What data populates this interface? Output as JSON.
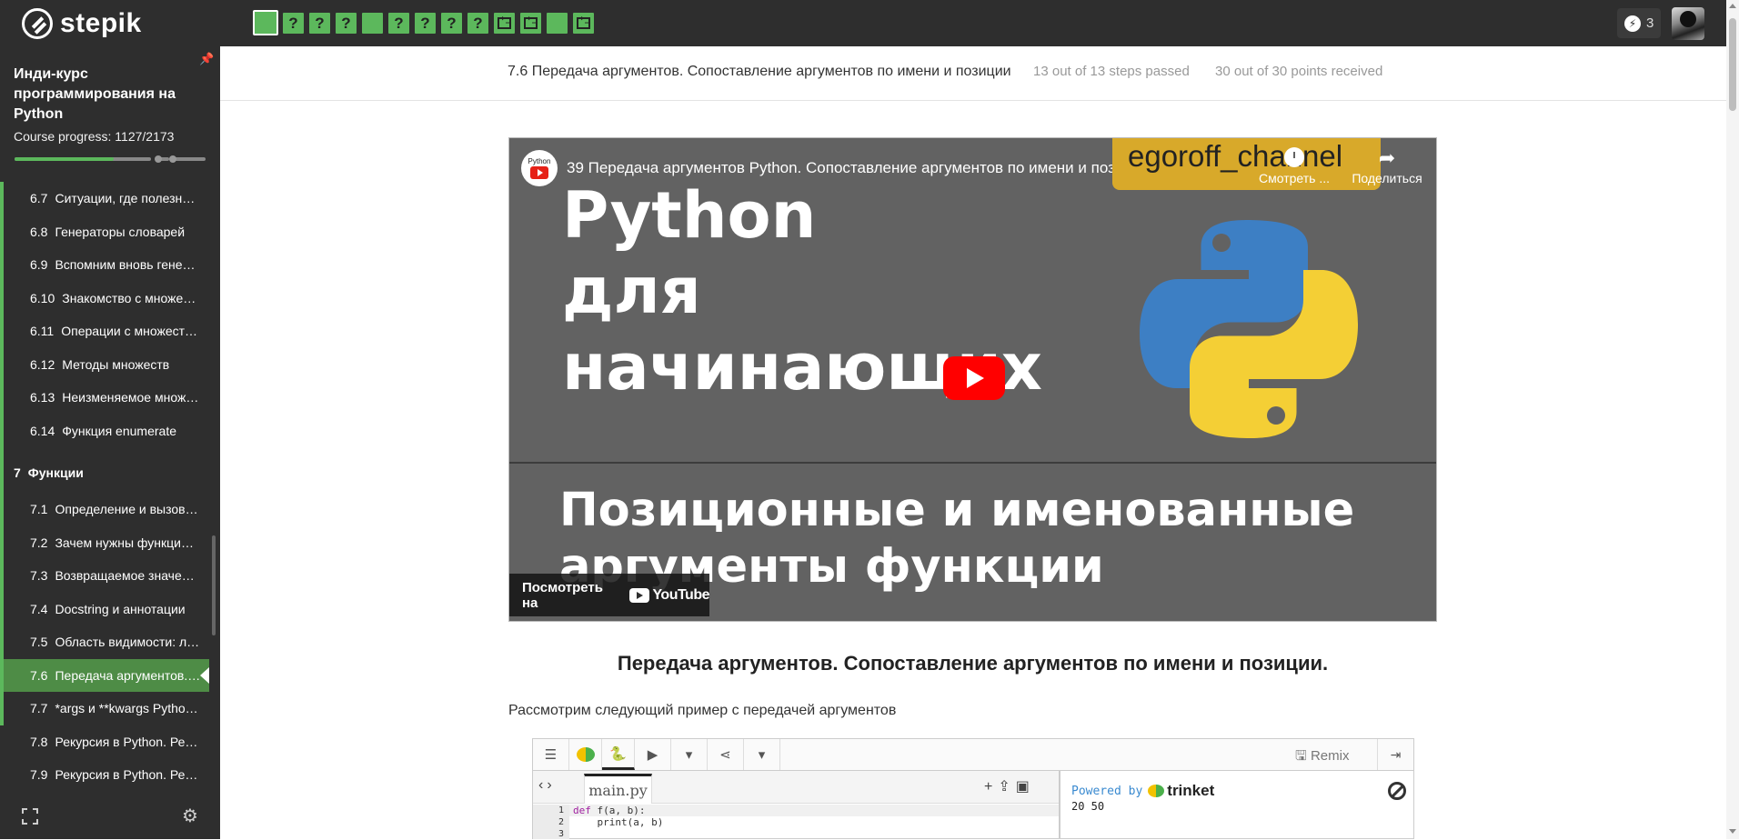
{
  "topbar": {
    "logo_text": "stepik",
    "steps": [
      {
        "kind": "check",
        "label": "",
        "active": true
      },
      {
        "kind": "question",
        "label": "?"
      },
      {
        "kind": "question",
        "label": "?"
      },
      {
        "kind": "question",
        "label": "?"
      },
      {
        "kind": "check",
        "label": ""
      },
      {
        "kind": "question",
        "label": "?"
      },
      {
        "kind": "question",
        "label": "?"
      },
      {
        "kind": "question",
        "label": "?"
      },
      {
        "kind": "question",
        "label": "?"
      },
      {
        "kind": "code",
        "label": ""
      },
      {
        "kind": "code",
        "label": ""
      },
      {
        "kind": "check",
        "label": ""
      },
      {
        "kind": "code",
        "label": ""
      }
    ],
    "energy_count": "3"
  },
  "sidebar": {
    "course_title": "Инди-курс программирования на Python",
    "progress_label": "Course progress:",
    "progress_value": "1127/2173",
    "progress_fraction": 0.52,
    "lessons": [
      {
        "num": "6.7",
        "title": "Ситуации, где полезно…",
        "type": "lesson"
      },
      {
        "num": "6.8",
        "title": "Генераторы словарей",
        "type": "lesson"
      },
      {
        "num": "6.9",
        "title": "Вспомним вновь гене…",
        "type": "lesson"
      },
      {
        "num": "6.10",
        "title": "Знакомство с множе…",
        "type": "lesson"
      },
      {
        "num": "6.11",
        "title": "Операции с множест…",
        "type": "lesson"
      },
      {
        "num": "6.12",
        "title": "Методы множеств",
        "type": "lesson"
      },
      {
        "num": "6.13",
        "title": "Неизменяемое множ…",
        "type": "lesson"
      },
      {
        "num": "6.14",
        "title": "Функция enumerate",
        "type": "lesson"
      },
      {
        "num": "7",
        "title": "Функции",
        "type": "module"
      },
      {
        "num": "7.1",
        "title": "Определение и вызов …",
        "type": "lesson"
      },
      {
        "num": "7.2",
        "title": "Зачем нужны функции…",
        "type": "lesson"
      },
      {
        "num": "7.3",
        "title": "Возвращаемое значен…",
        "type": "lesson"
      },
      {
        "num": "7.4",
        "title": "Docstring и аннотации",
        "type": "lesson"
      },
      {
        "num": "7.5",
        "title": "Область видимости: л…",
        "type": "lesson"
      },
      {
        "num": "7.6",
        "title": "Передача аргументов.…",
        "type": "current"
      },
      {
        "num": "7.7",
        "title": "*args и **kwargs Pytho…",
        "type": "lesson"
      },
      {
        "num": "7.8",
        "title": "Рекурсия в Python. Ре…",
        "type": "plain"
      },
      {
        "num": "7.9",
        "title": "Рекурсия в Python. Ре…",
        "type": "plain"
      }
    ]
  },
  "header": {
    "lesson_title": "7.6 Передача аргументов. Сопоставление аргументов по имени и позиции",
    "steps_passed": "13 out of 13 steps passed",
    "points_received": "30 out of 30 points  received"
  },
  "video": {
    "channel_avatar_text": "Python",
    "title": "39 Передача аргументов Python. Сопоставление аргументов по имени и позиции",
    "channel_name": "egoroff_channel",
    "watch_later_label": "Смотреть ...",
    "share_label": "Поделиться",
    "thumb_line1": "Python",
    "thumb_line2": "для",
    "thumb_line3": "начинающих",
    "thumb_line4": "Позиционные и именованные",
    "thumb_line5": "аргументы функции",
    "watch_on_label": "Посмотреть на",
    "youtube_label": "YouTube"
  },
  "article": {
    "heading": "Передача аргументов. Сопоставление аргументов по имени и позиции.",
    "text": "Рассмотрим следующий пример с передачей аргументов"
  },
  "trinket": {
    "remix_label": "Remix",
    "file_name": "main.py",
    "line_numbers": [
      "1",
      "2",
      "3"
    ],
    "code_line1_kw": "def",
    "code_line1_rest": " f(a, b):",
    "code_line2": "    print(a, b)",
    "powered_by": "Powered by",
    "brand": "trinket",
    "output": "20 50"
  },
  "colors": {
    "dark_bg": "#2e2e2e",
    "accent_green": "#5cb85c",
    "current_lesson": "#4e8c46",
    "youtube_red": "#ff0000"
  }
}
